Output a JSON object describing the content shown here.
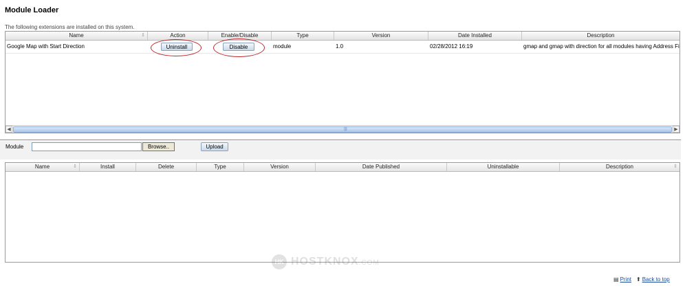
{
  "page": {
    "title": "Module Loader",
    "subtitle": "The following extensions are installed on this system."
  },
  "installed": {
    "columns": [
      "Name",
      "Action",
      "Enable/Disable",
      "Type",
      "Version",
      "Date Installed",
      "Description"
    ],
    "rows": [
      {
        "name": "Google Map with Start Direction",
        "action": "Uninstall",
        "toggle": "Disable",
        "type": "module",
        "version": "1.0",
        "date_installed": "02/28/2012 16:19",
        "description": "gmap and gmap with direction for all modules having Address Fie"
      }
    ]
  },
  "upload": {
    "module_label": "Module",
    "browse_label": "Browse..",
    "upload_label": "Upload",
    "file_value": ""
  },
  "available": {
    "columns": [
      "Name",
      "Install",
      "Delete",
      "Type",
      "Version",
      "Date Published",
      "Uninstallable",
      "Description"
    ]
  },
  "watermark": {
    "logo": "HK",
    "text": "HOSTKNOX",
    "suffix": ".COM"
  },
  "footer": {
    "print_label": "Print",
    "back_label": "Back to top"
  },
  "icons": {
    "sort": "sort-icon",
    "print": "printer-icon",
    "back": "arrow-up-icon",
    "scroll_left": "chevron-left-icon",
    "scroll_right": "chevron-right-icon"
  },
  "colors": {
    "annotation_oval": "#c0262c",
    "button_gradient_top": "#f4f8fc",
    "button_gradient_bottom": "#c9d9ea",
    "scroll_thumb": "#a9c5e8",
    "link": "#1a4c9a"
  }
}
